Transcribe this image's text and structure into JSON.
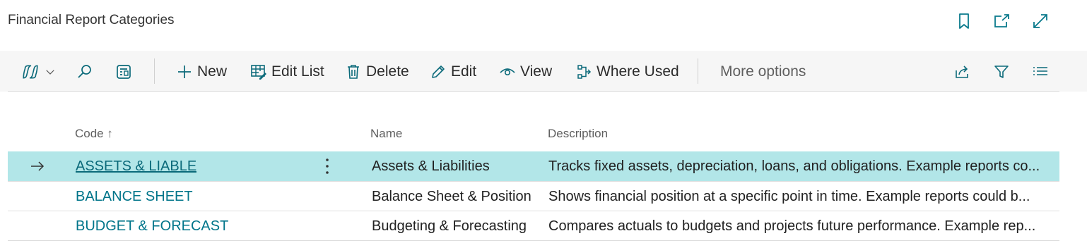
{
  "page": {
    "title": "Financial Report Categories"
  },
  "top_icons": [
    "bookmark-icon",
    "open-in-new-window-icon",
    "expand-icon"
  ],
  "toolbar": {
    "copilot_icon": "copilot-icon",
    "new_label": "New",
    "edit_list_label": "Edit List",
    "delete_label": "Delete",
    "edit_label": "Edit",
    "view_label": "View",
    "where_used_label": "Where Used",
    "more_options_label": "More options"
  },
  "table": {
    "headers": {
      "code": "Code",
      "sort_indicator": "↑",
      "name": "Name",
      "description": "Description"
    },
    "rows": [
      {
        "code": "ASSETS & LIABLE",
        "name": "Assets & Liabilities",
        "description": "Tracks fixed assets, depreciation, loans, and obligations. Example reports co...",
        "selected": true
      },
      {
        "code": "BALANCE SHEET",
        "name": "Balance Sheet & Position",
        "description": "Shows financial position at a specific point in time. Example reports could b...",
        "selected": false
      },
      {
        "code": "BUDGET & FORECAST",
        "name": "Budgeting & Forecasting",
        "description": "Compares actuals to budgets and projects future performance. Example rep...",
        "selected": false
      }
    ]
  },
  "colors": {
    "accent": "#00758a",
    "selected_row": "#b2e6e8",
    "toolbar_bg": "#f6f6f6"
  }
}
